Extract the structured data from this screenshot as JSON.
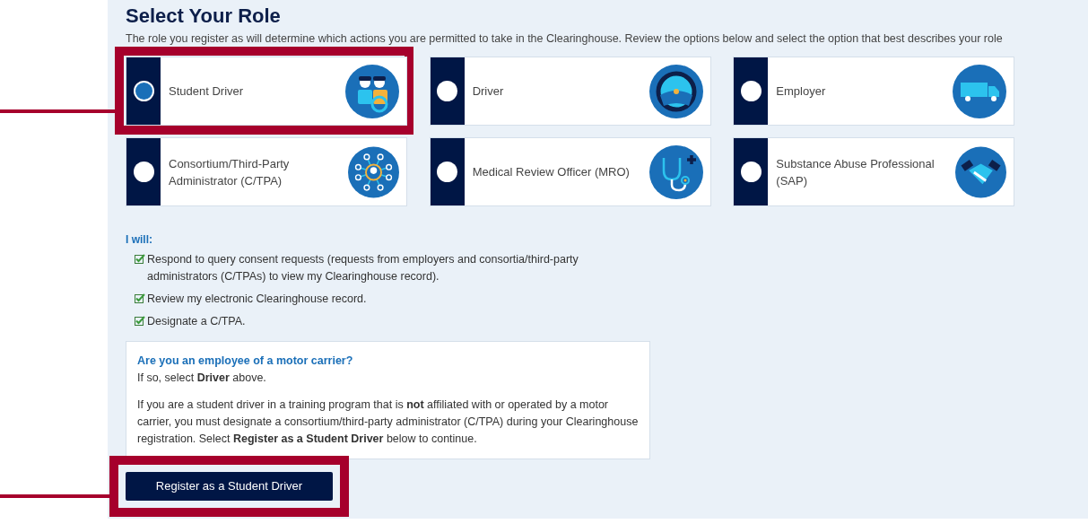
{
  "title": "Select Your Role",
  "description": "The role you register as will determine which actions you are permitted to take in the Clearinghouse. Review the options below and select the option that best describes your role",
  "roles": [
    {
      "label": "Student Driver",
      "selected": true
    },
    {
      "label": "Driver",
      "selected": false
    },
    {
      "label": "Employer",
      "selected": false
    },
    {
      "label": "Consortium/Third-Party Administrator (C/TPA)",
      "selected": false
    },
    {
      "label": "Medical Review Officer (MRO)",
      "selected": false
    },
    {
      "label": "Substance Abuse Professional (SAP)",
      "selected": false
    }
  ],
  "permissions": {
    "heading": "I will:",
    "items": [
      "Respond to query consent requests (requests from employers and consortia/third-party administrators (C/TPAs) to view my Clearinghouse record).",
      "Review my electronic Clearinghouse record.",
      "Designate a C/TPA."
    ]
  },
  "notice": {
    "heading": "Are you an employee of a motor carrier?",
    "paragraphs": [
      "If so, select **Driver** above.",
      "If you are a student driver in a training program that is **not** affiliated with or operated by a motor carrier, you must designate a consortium/third-party administrator (C/TPA) during your Clearinghouse registration. Select **Register as a Student Driver** below to continue."
    ]
  },
  "button": "Register as a Student Driver"
}
